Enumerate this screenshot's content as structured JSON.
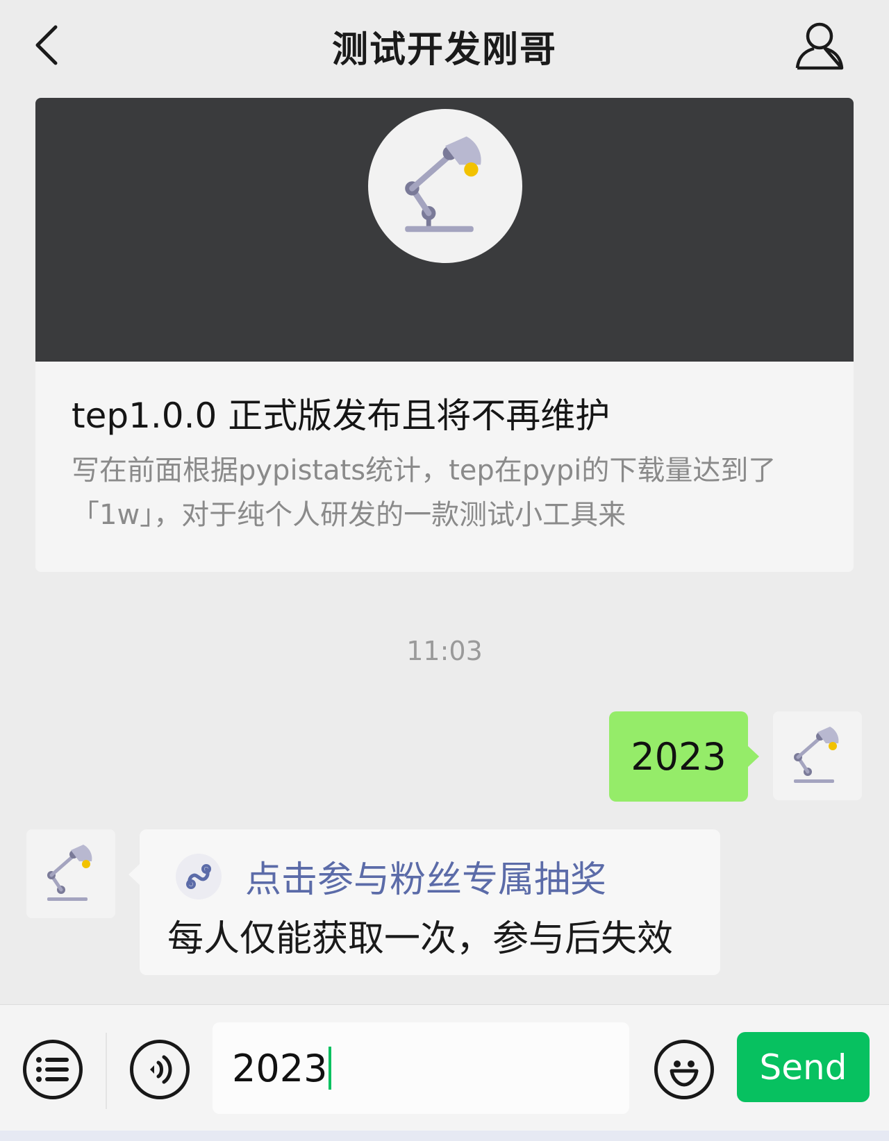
{
  "header": {
    "title": "测试开发刚哥",
    "back_icon": "chevron-left-icon",
    "profile_icon": "person-icon"
  },
  "article": {
    "title": "tep1.0.0 正式版发布且将不再维护",
    "description": "写在前面根据pypistats统计，tep在pypi的下载量达到了「1w」，对于纯个人研发的一款测试小工具来",
    "cover_icon": "desk-lamp-icon"
  },
  "chat": {
    "timestamp": "11:03",
    "outgoing": {
      "text": "2023"
    },
    "incoming": {
      "link_label": "点击参与粉丝专属抽奖",
      "text": "每人仅能获取一次，参与后失效"
    }
  },
  "input_bar": {
    "input_value": "2023",
    "send_label": "Send",
    "menu_icon": "list-menu-icon",
    "voice_icon": "voice-icon",
    "emoji_icon": "smiley-icon"
  },
  "colors": {
    "accent_green": "#07c160",
    "bubble_green": "#95ec69",
    "link_blue": "#5b6ba8"
  }
}
